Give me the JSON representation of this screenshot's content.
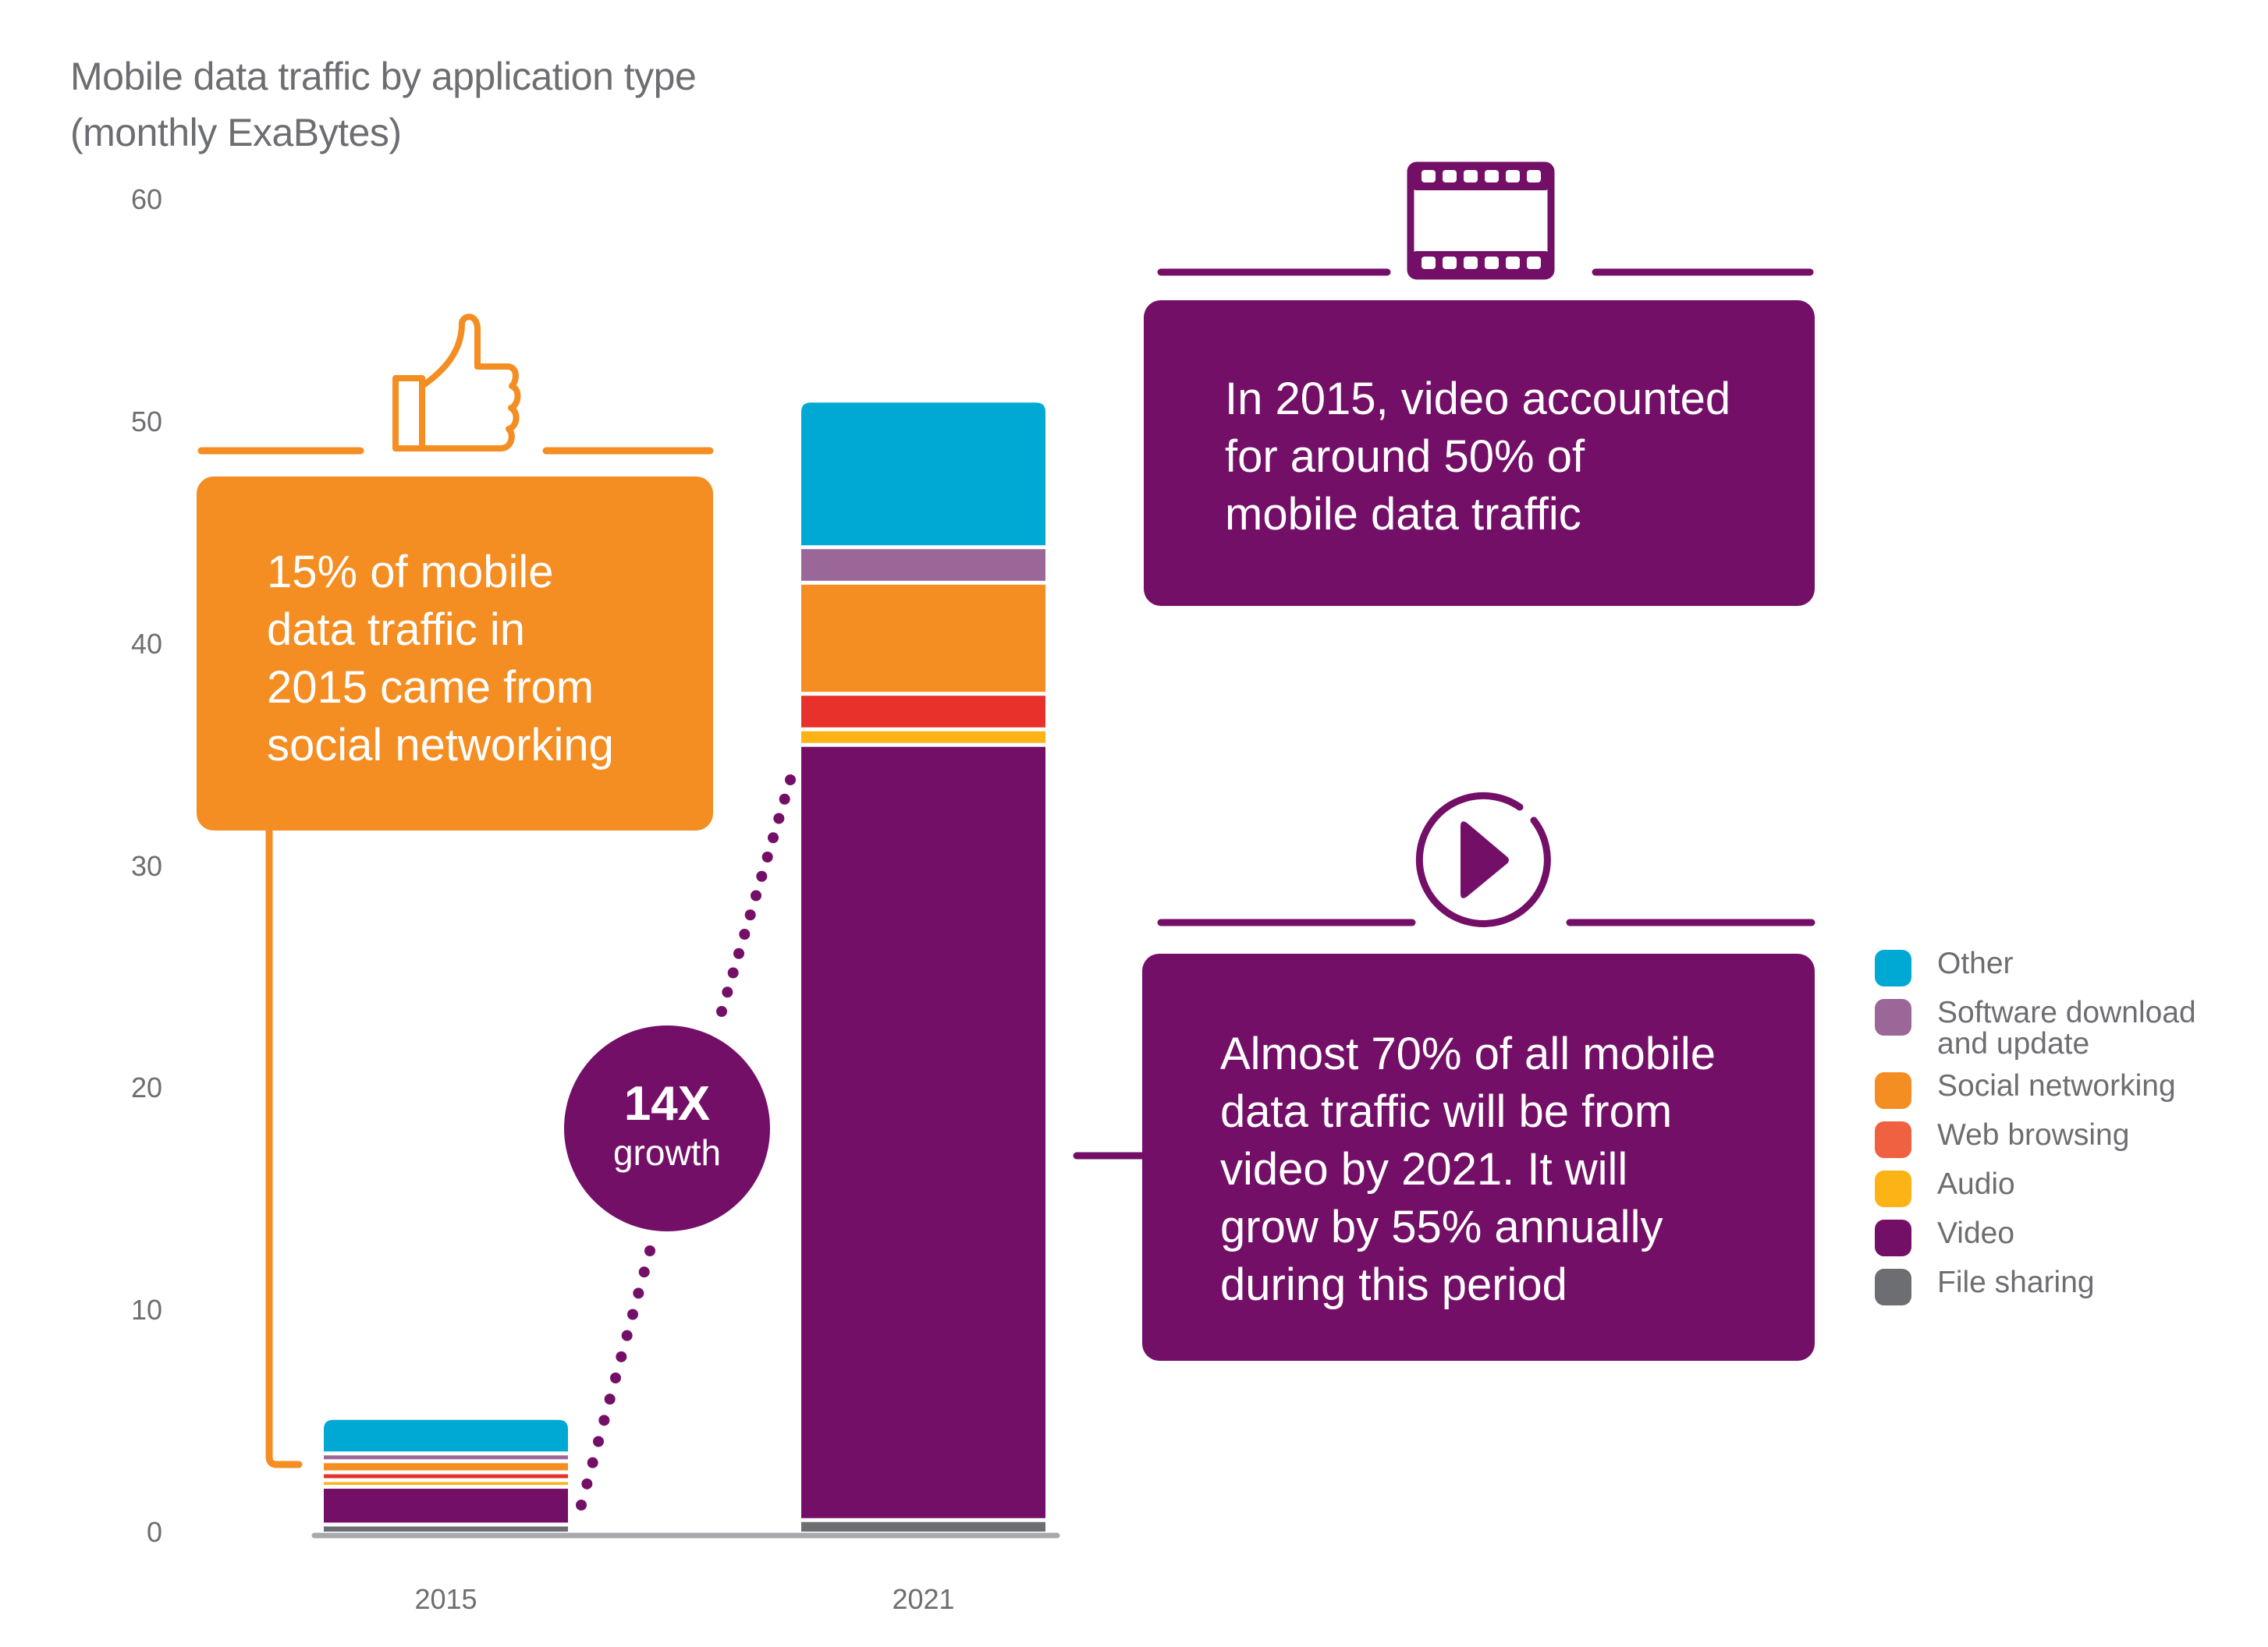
{
  "title": {
    "line1": "Mobile data traffic by application type",
    "line2": "(monthly ExaBytes)"
  },
  "colors": {
    "orange": "#f48d22",
    "purple": "#740f68",
    "axis": "#a7a9ac",
    "text_gray": "#6d6e71"
  },
  "callouts": {
    "social": {
      "icon": "thumbs-up-icon",
      "lines": [
        "15% of mobile",
        "data traffic in",
        "2015 came from",
        "social networking"
      ]
    },
    "video_2015": {
      "icon": "film-strip-icon",
      "lines": [
        "In 2015, video accounted",
        "for around 50% of",
        "mobile data traffic"
      ]
    },
    "video_2021": {
      "icon": "play-icon",
      "lines": [
        "Almost 70% of all mobile",
        "data traffic will be from",
        "video by 2021. It will",
        "grow by 55% annually",
        "during this period"
      ]
    },
    "growth": {
      "value": "14X",
      "label": "growth"
    }
  },
  "chart_data": {
    "type": "bar",
    "stacked": true,
    "title": "Mobile data traffic by application type (monthly ExaBytes)",
    "xlabel": "",
    "ylabel": "",
    "categories": [
      "2015",
      "2021"
    ],
    "ylim": [
      0,
      60
    ],
    "yticks": [
      0,
      10,
      20,
      30,
      40,
      50,
      60
    ],
    "grid": false,
    "legend_position": "right",
    "series": [
      {
        "name": "File sharing",
        "color": "#6d6e71",
        "values": [
          0.3,
          0.5
        ]
      },
      {
        "name": "Video",
        "color": "#740f68",
        "values": [
          1.7,
          34.9
        ]
      },
      {
        "name": "Audio",
        "color": "#fbb316",
        "values": [
          0.3,
          0.7
        ]
      },
      {
        "name": "Web browsing",
        "color": "#e8312a",
        "values": [
          0.35,
          1.6
        ]
      },
      {
        "name": "Social networking",
        "color": "#f48d22",
        "values": [
          0.5,
          5.0
        ]
      },
      {
        "name": "Software download and update",
        "color": "#9b6799",
        "values": [
          0.35,
          1.6
        ]
      },
      {
        "name": "Other",
        "color": "#00a9d4",
        "values": [
          1.6,
          6.6
        ]
      }
    ],
    "legend": [
      {
        "label_lines": [
          "Other"
        ],
        "color": "#00a9d4"
      },
      {
        "label_lines": [
          "Software download",
          "and update"
        ],
        "color": "#9b6799"
      },
      {
        "label_lines": [
          "Social networking"
        ],
        "color": "#f48d22"
      },
      {
        "label_lines": [
          "Web browsing"
        ],
        "color": "#ef6140"
      },
      {
        "label_lines": [
          "Audio"
        ],
        "color": "#fbb316"
      },
      {
        "label_lines": [
          "Video"
        ],
        "color": "#740f68"
      },
      {
        "label_lines": [
          "File sharing"
        ],
        "color": "#6d6e71"
      }
    ],
    "annotations": [
      "14X growth"
    ]
  }
}
